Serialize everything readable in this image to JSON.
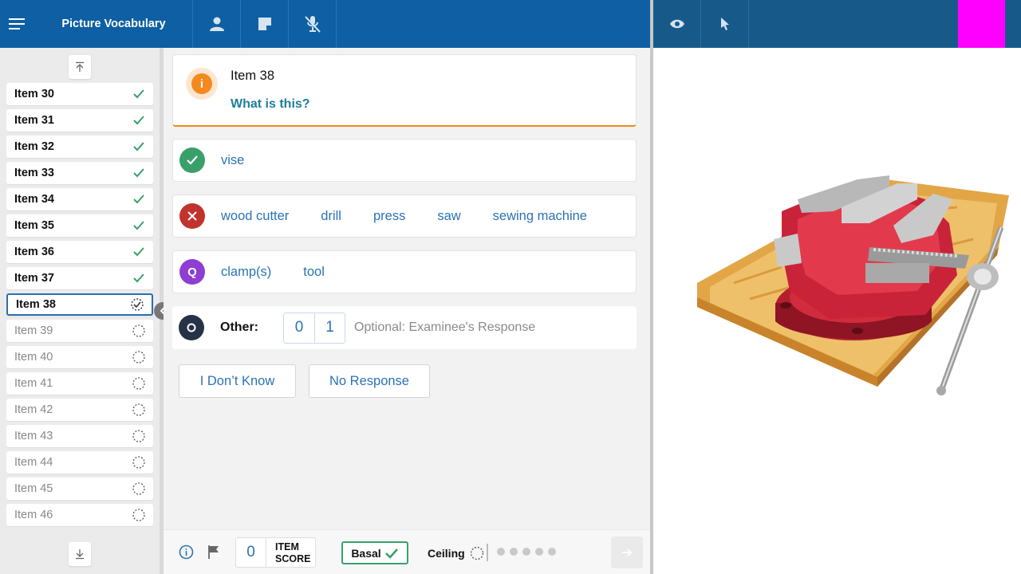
{
  "app": {
    "title": "Picture Vocabulary"
  },
  "colors": {
    "topbar": "#0e5fa3",
    "correct": "#3aa06b",
    "incorrect": "#c0332f",
    "query": "#8e3ed1",
    "other": "#263245",
    "info": "#f5891f",
    "accent": "#2a73b3",
    "magenta": "#ff00ff"
  },
  "sidebar": {
    "items": [
      {
        "label": "Item 30",
        "status": "done"
      },
      {
        "label": "Item 31",
        "status": "done"
      },
      {
        "label": "Item 32",
        "status": "done"
      },
      {
        "label": "Item 33",
        "status": "done"
      },
      {
        "label": "Item 34",
        "status": "done"
      },
      {
        "label": "Item 35",
        "status": "done"
      },
      {
        "label": "Item 36",
        "status": "done"
      },
      {
        "label": "Item 37",
        "status": "done"
      },
      {
        "label": "Item 38",
        "status": "current"
      },
      {
        "label": "Item 39",
        "status": "pending"
      },
      {
        "label": "Item 40",
        "status": "pending"
      },
      {
        "label": "Item 41",
        "status": "pending"
      },
      {
        "label": "Item 42",
        "status": "pending"
      },
      {
        "label": "Item 43",
        "status": "pending"
      },
      {
        "label": "Item 44",
        "status": "pending"
      },
      {
        "label": "Item 45",
        "status": "pending"
      },
      {
        "label": "Item 46",
        "status": "pending"
      }
    ]
  },
  "question": {
    "item_title": "Item 38",
    "prompt": "What is this?",
    "icon": "i"
  },
  "responses": {
    "correct": [
      "vise"
    ],
    "incorrect": [
      "wood cutter",
      "drill",
      "press",
      "saw",
      "sewing machine"
    ],
    "query": [
      "clamp(s)",
      "tool"
    ],
    "query_badge": "Q",
    "other_label": "Other:",
    "other_scores": [
      "0",
      "1"
    ],
    "other_placeholder": "Optional: Examinee's Response"
  },
  "buttons": {
    "dont_know": "I Don’t Know",
    "no_response": "No Response"
  },
  "footer": {
    "item_score_value": "0",
    "item_score_label_1": "ITEM",
    "item_score_label_2": "SCORE",
    "basal_label": "Basal",
    "ceiling_label": "Ceiling",
    "ceiling_dots": 5
  }
}
